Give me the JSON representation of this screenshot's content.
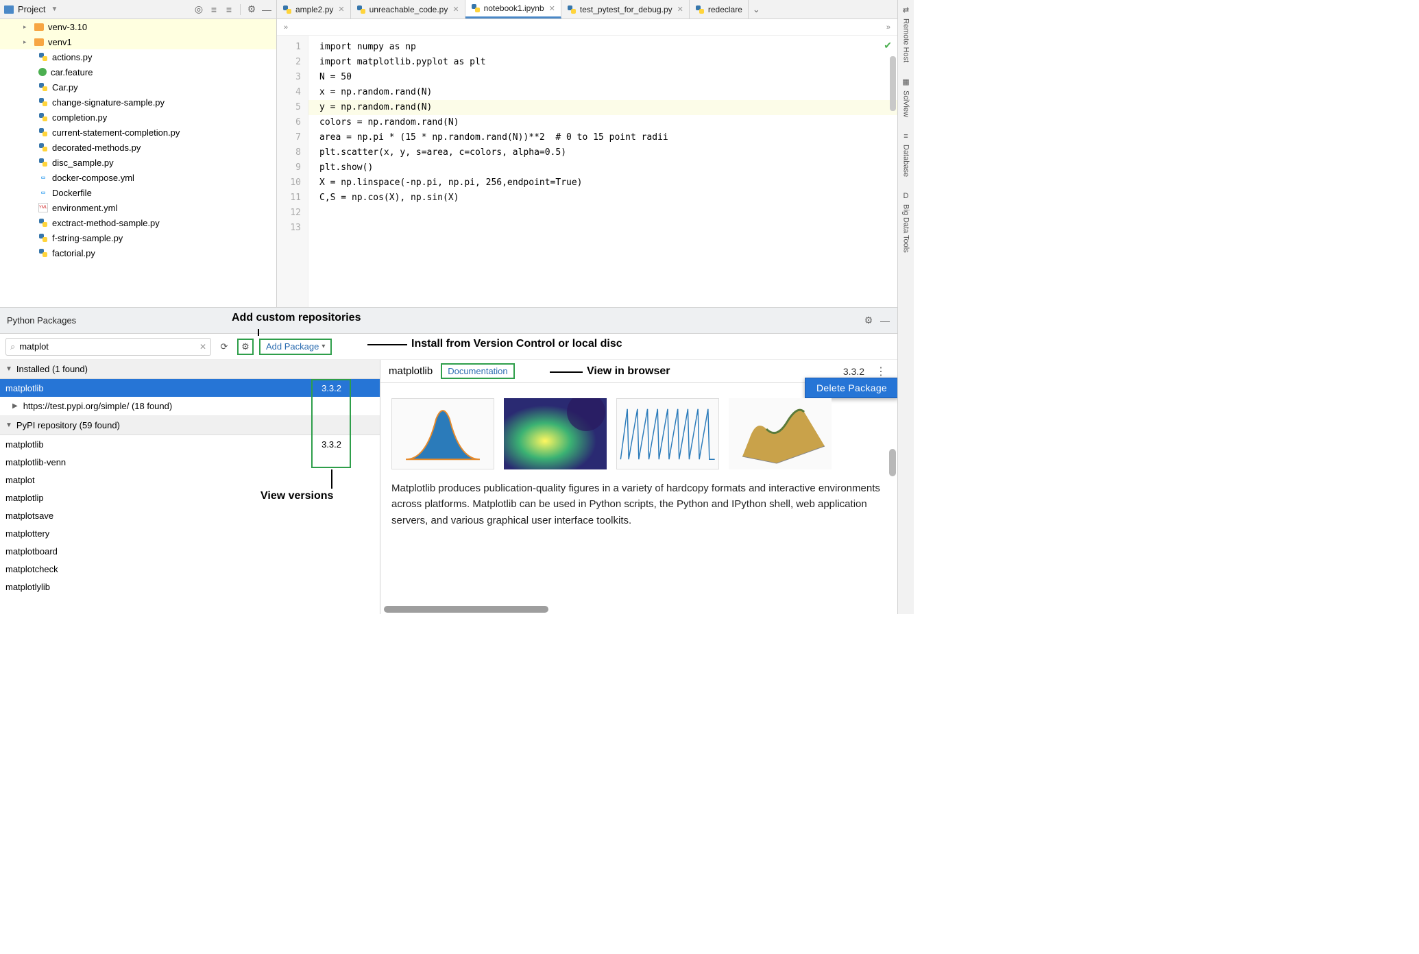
{
  "project": {
    "label": "Project",
    "tree": [
      {
        "type": "folder",
        "expand": "▸",
        "name": "venv-3.10",
        "indent": 1,
        "hl": true
      },
      {
        "type": "folder",
        "expand": "▸",
        "name": "venv1",
        "indent": 1,
        "hl": true
      },
      {
        "type": "py",
        "name": "actions.py",
        "indent": 2
      },
      {
        "type": "feature",
        "name": "car.feature",
        "indent": 2
      },
      {
        "type": "py",
        "name": "Car.py",
        "indent": 2
      },
      {
        "type": "py",
        "name": "change-signature-sample.py",
        "indent": 2
      },
      {
        "type": "py",
        "name": "completion.py",
        "indent": 2
      },
      {
        "type": "py",
        "name": "current-statement-completion.py",
        "indent": 2
      },
      {
        "type": "py",
        "name": "decorated-methods.py",
        "indent": 2
      },
      {
        "type": "py",
        "name": "disc_sample.py",
        "indent": 2
      },
      {
        "type": "docker",
        "name": "docker-compose.yml",
        "indent": 2
      },
      {
        "type": "docker",
        "name": "Dockerfile",
        "indent": 2
      },
      {
        "type": "yml",
        "name": "environment.yml",
        "indent": 2
      },
      {
        "type": "py",
        "name": "exctract-method-sample.py",
        "indent": 2
      },
      {
        "type": "py",
        "name": "f-string-sample.py",
        "indent": 2
      },
      {
        "type": "py",
        "name": "factorial.py",
        "indent": 2
      }
    ]
  },
  "tabs": [
    {
      "label": "ample2.py",
      "icon": "py",
      "active": false,
      "truncated_left": true
    },
    {
      "label": "unreachable_code.py",
      "icon": "py",
      "active": false
    },
    {
      "label": "notebook1.ipynb",
      "icon": "ipynb",
      "active": true
    },
    {
      "label": "test_pytest_for_debug.py",
      "icon": "py",
      "active": false
    },
    {
      "label": "redeclare",
      "icon": "py",
      "active": false,
      "truncated_right": true
    }
  ],
  "breadcrumb": "»",
  "code_lines": [
    "import numpy as np",
    "import matplotlib.pyplot as plt",
    "N = 50",
    "x = np.random.rand(N)",
    "y = np.random.rand(N)",
    "colors = np.random.rand(N)",
    "area = np.pi * (15 * np.random.rand(N))**2  # 0 to 15 point radii",
    "plt.scatter(x, y, s=area, c=colors, alpha=0.5)",
    "plt.show()",
    "",
    "X = np.linspace(-np.pi, np.pi, 256,endpoint=True)",
    "C,S = np.cos(X), np.sin(X)",
    ""
  ],
  "highlighted_line_index": 4,
  "packages": {
    "title": "Python Packages",
    "search_value": "matplot",
    "add_button": "Add Package",
    "annotations": {
      "add_repos": "Add custom repositories",
      "install_vc": "Install from Version Control or local disc",
      "view_browser": "View in browser",
      "view_versions": "View versions"
    },
    "installed_header": "Installed (1 found)",
    "installed": [
      {
        "name": "matplotlib",
        "version": "3.3.2"
      }
    ],
    "sub_repo": {
      "label": "https://test.pypi.org/simple/ (18 found)"
    },
    "pypi_header": "PyPI repository (59 found)",
    "pypi": [
      {
        "name": "matplotlib",
        "version": "3.3.2"
      },
      {
        "name": "matplotlib-venn"
      },
      {
        "name": "matplot"
      },
      {
        "name": "matplotlip"
      },
      {
        "name": "matplotsave"
      },
      {
        "name": "matplottery"
      },
      {
        "name": "matplotboard"
      },
      {
        "name": "matplotcheck"
      },
      {
        "name": "matplotlylib"
      }
    ],
    "detail": {
      "name": "matplotlib",
      "doc_label": "Documentation",
      "version": "3.3.2",
      "delete_label": "Delete Package",
      "description": "Matplotlib produces publication-quality figures in a variety of hardcopy formats and interactive environments across platforms. Matplotlib can be used in Python scripts, the Python and IPython shell, web application servers, and various graphical user interface toolkits."
    }
  },
  "right_tools": [
    "Remote Host",
    "SciView",
    "Database",
    "Big Data Tools"
  ],
  "right_tool_icons": [
    "⇄",
    "▦",
    "≡",
    "D"
  ]
}
